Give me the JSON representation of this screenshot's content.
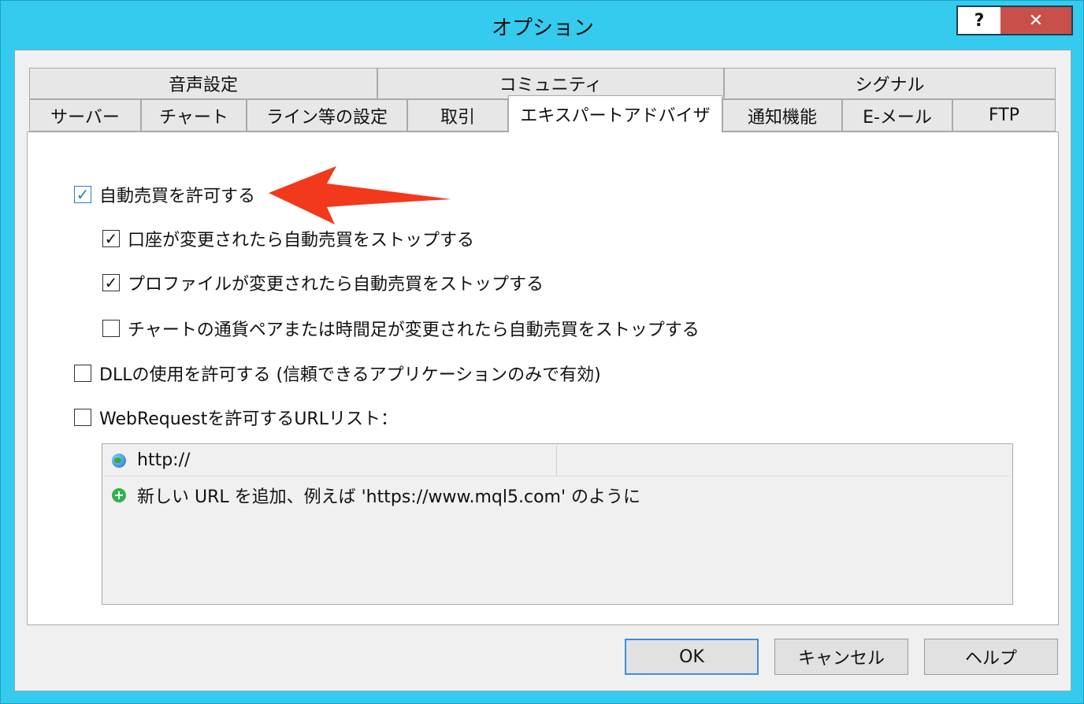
{
  "window": {
    "title": "オプション",
    "help_label": "?",
    "close_label": "✕"
  },
  "tabs_row1": [
    "音声設定",
    "コミュニティ",
    "シグナル"
  ],
  "tabs_row2": [
    "サーバー",
    "チャート",
    "ライン等の設定",
    "取引",
    "エキスパートアドバイザ",
    "通知機能",
    "E-メール",
    "FTP"
  ],
  "options": {
    "allow_auto_trading": "自動売買を許可する",
    "stop_on_account_change": "口座が変更されたら自動売買をストップする",
    "stop_on_profile_change": "プロファイルが変更されたら自動売買をストップする",
    "stop_on_chart_change": "チャートの通貨ペアまたは時間足が変更されたら自動売買をストップする",
    "allow_dll": "DLLの使用を許可する (信頼できるアプリケーションのみで有効)",
    "allow_webrequest": "WebRequestを許可するURLリスト："
  },
  "checks": {
    "allow_auto_trading": true,
    "stop_on_account_change": true,
    "stop_on_profile_change": true,
    "stop_on_chart_change": false,
    "allow_dll": false,
    "allow_webrequest": false
  },
  "url_list": {
    "header": "http://",
    "add_hint": "新しい URL を追加、例えば 'https://www.mql5.com' のように"
  },
  "buttons": {
    "ok": "OK",
    "cancel": "キャンセル",
    "help": "ヘルプ"
  },
  "colors": {
    "titlebar": "#34cbef",
    "close_button": "#c7504a",
    "annotation_arrow": "#f2391c"
  }
}
